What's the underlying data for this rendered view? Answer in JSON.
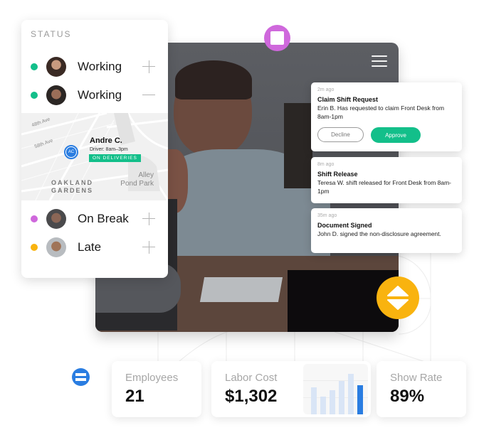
{
  "status_panel": {
    "title": "STATUS",
    "rows": [
      {
        "label": "Working",
        "status_color": "#13bf8a",
        "control": "plus"
      },
      {
        "label": "Working",
        "status_color": "#13bf8a",
        "control": "minus"
      },
      {
        "label": "On Break",
        "status_color": "#cf68dc",
        "control": "plus"
      },
      {
        "label": "Late",
        "status_color": "#f9b30f",
        "control": "plus"
      }
    ],
    "map": {
      "streets": [
        "48th Ave",
        "58th Ave"
      ],
      "pin_initials": "AC",
      "driver_name": "Andre C.",
      "driver_shift": "Driver: 8am–3pm",
      "badge": "ON DELIVERIES",
      "area_label_line1": "OAKLAND",
      "area_label_line2": "GARDENS",
      "park_line1": "Alley",
      "park_line2": "Pond Park"
    }
  },
  "photo_panel": {
    "menu_icon": "hamburger-icon"
  },
  "notifications": [
    {
      "time": "2m ago",
      "title": "Claim Shift Request",
      "body": "Erin B. Has requested to claim Front Desk from 8am-1pm",
      "actions": {
        "decline": "Decline",
        "approve": "Approve"
      }
    },
    {
      "time": "8m ago",
      "title": "Shift Release",
      "body": "Teresa W. shift released for Front Desk from 8am-1pm"
    },
    {
      "time": "35m ago",
      "title": "Document Signed",
      "body": "John D. signed the non-disclosure agreement."
    }
  ],
  "floating_icons": {
    "purple": "square-icon",
    "yellow": "sort-arrows-icon",
    "blue": "equals-icon"
  },
  "stats": [
    {
      "label": "Employees",
      "value": "21"
    },
    {
      "label": "Labor Cost",
      "value": "$1,302"
    },
    {
      "label": "Show Rate",
      "value": "89%"
    }
  ],
  "mini_chart": {
    "type": "bar",
    "values": [
      0.62,
      0.4,
      0.55,
      0.75,
      0.92,
      0.66
    ],
    "highlighted_index": 5
  },
  "colors": {
    "green": "#13bf8a",
    "purple": "#cf68dc",
    "yellow": "#f9b30f",
    "blue": "#2a7de1"
  }
}
